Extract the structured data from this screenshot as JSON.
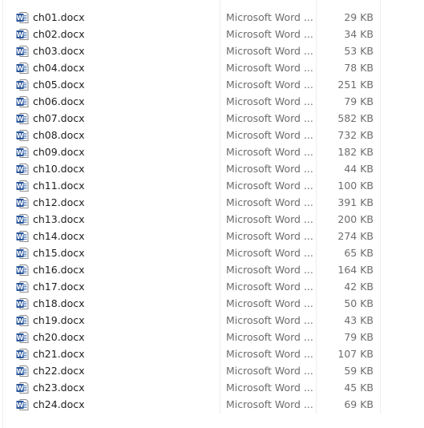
{
  "files": [
    {
      "name": "ch01.docx",
      "type": "Microsoft Word ...",
      "size": "29 KB"
    },
    {
      "name": "ch02.docx",
      "type": "Microsoft Word ...",
      "size": "34 KB"
    },
    {
      "name": "ch03.docx",
      "type": "Microsoft Word ...",
      "size": "53 KB"
    },
    {
      "name": "ch04.docx",
      "type": "Microsoft Word ...",
      "size": "78 KB"
    },
    {
      "name": "ch05.docx",
      "type": "Microsoft Word ...",
      "size": "251 KB"
    },
    {
      "name": "ch06.docx",
      "type": "Microsoft Word ...",
      "size": "79 KB"
    },
    {
      "name": "ch07.docx",
      "type": "Microsoft Word ...",
      "size": "582 KB"
    },
    {
      "name": "ch08.docx",
      "type": "Microsoft Word ...",
      "size": "732 KB"
    },
    {
      "name": "ch09.docx",
      "type": "Microsoft Word ...",
      "size": "182 KB"
    },
    {
      "name": "ch10.docx",
      "type": "Microsoft Word ...",
      "size": "44 KB"
    },
    {
      "name": "ch11.docx",
      "type": "Microsoft Word ...",
      "size": "100 KB"
    },
    {
      "name": "ch12.docx",
      "type": "Microsoft Word ...",
      "size": "391 KB"
    },
    {
      "name": "ch13.docx",
      "type": "Microsoft Word ...",
      "size": "200 KB"
    },
    {
      "name": "ch14.docx",
      "type": "Microsoft Word ...",
      "size": "274 KB"
    },
    {
      "name": "ch15.docx",
      "type": "Microsoft Word ...",
      "size": "65 KB"
    },
    {
      "name": "ch16.docx",
      "type": "Microsoft Word ...",
      "size": "164 KB"
    },
    {
      "name": "ch17.docx",
      "type": "Microsoft Word ...",
      "size": "42 KB"
    },
    {
      "name": "ch18.docx",
      "type": "Microsoft Word ...",
      "size": "50 KB"
    },
    {
      "name": "ch19.docx",
      "type": "Microsoft Word ...",
      "size": "43 KB"
    },
    {
      "name": "ch20.docx",
      "type": "Microsoft Word ...",
      "size": "79 KB"
    },
    {
      "name": "ch21.docx",
      "type": "Microsoft Word ...",
      "size": "107 KB"
    },
    {
      "name": "ch22.docx",
      "type": "Microsoft Word ...",
      "size": "59 KB"
    },
    {
      "name": "ch23.docx",
      "type": "Microsoft Word ...",
      "size": "45 KB"
    },
    {
      "name": "ch24.docx",
      "type": "Microsoft Word ...",
      "size": "69 KB"
    }
  ],
  "icon": {
    "name": "word-document-icon",
    "letter": "W",
    "color": "#2b579a"
  }
}
